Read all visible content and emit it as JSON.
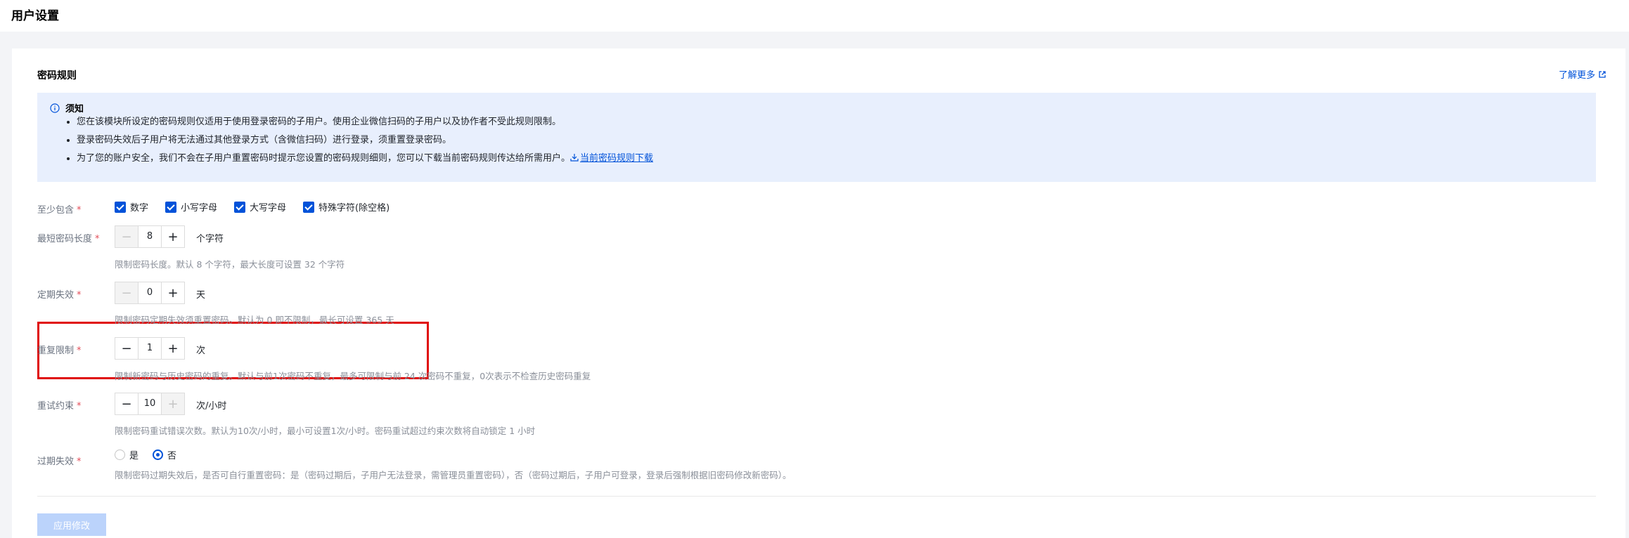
{
  "page": {
    "title": "用户设置"
  },
  "card": {
    "title": "密码规则",
    "learn_more": "了解更多"
  },
  "notice": {
    "title": "须知",
    "items": [
      "您在该模块所设定的密码规则仅适用于使用登录密码的子用户。使用企业微信扫码的子用户以及协作者不受此规则限制。",
      "登录密码失效后子用户将无法通过其他登录方式（含微信扫码）进行登录，须重置登录密码。",
      "为了您的账户安全，我们不会在子用户重置密码时提示您设置的密码规则细则，您可以下载当前密码规则传达给所需用户。"
    ],
    "download_link": "当前密码规则下载"
  },
  "rules": {
    "include": {
      "label": "至少包含",
      "options": [
        {
          "label": "数字",
          "checked": true
        },
        {
          "label": "小写字母",
          "checked": true
        },
        {
          "label": "大写字母",
          "checked": true
        },
        {
          "label": "特殊字符(除空格)",
          "checked": true
        }
      ]
    },
    "min_length": {
      "label": "最短密码长度",
      "value": "8",
      "unit": "个字符",
      "help": "限制密码长度。默认 8 个字符，最大长度可设置 32 个字符"
    },
    "expire": {
      "label": "定期失效",
      "value": "0",
      "unit": "天",
      "help": "限制密码定期失效须重置密码。默认为 0 即不限制，最长可设置 365 天"
    },
    "repeat": {
      "label": "重复限制",
      "value": "1",
      "unit": "次",
      "help": "限制新密码与历史密码的重复。默认与前1次密码不重复，最多可限制与前 24 次密码不重复，0次表示不检查历史密码重复"
    },
    "retry": {
      "label": "重试约束",
      "value": "10",
      "unit": "次/小时",
      "help": "限制密码重试错误次数。默认为10次/小时，最小可设置1次/小时。密码重试超过约束次数将自动锁定 1 小时"
    },
    "expired": {
      "label": "过期失效",
      "options": [
        {
          "label": "是",
          "selected": false
        },
        {
          "label": "否",
          "selected": true
        }
      ],
      "help": "限制密码过期失效后，是否可自行重置密码：是（密码过期后，子用户无法登录，需管理员重置密码），否（密码过期后，子用户可登录，登录后强制根据旧密码修改新密码）。"
    }
  },
  "actions": {
    "apply": "应用修改"
  },
  "colors": {
    "accent": "#0052d9",
    "required": "#e34d59",
    "highlight_border": "#e00b0b",
    "notice_bg": "#e8effd"
  },
  "icons": [
    "info-icon",
    "external-link-icon",
    "download-icon",
    "check-icon",
    "minus-icon",
    "plus-icon"
  ]
}
